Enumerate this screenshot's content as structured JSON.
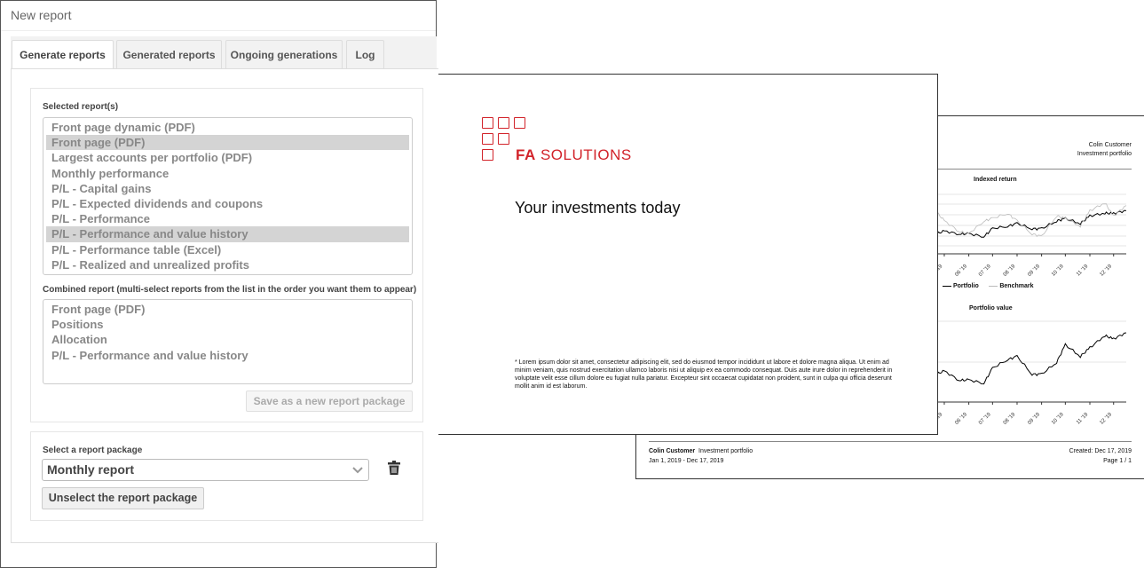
{
  "window": {
    "title": "New report"
  },
  "tabs": [
    {
      "label": "Generate reports",
      "active": true
    },
    {
      "label": "Generated reports"
    },
    {
      "label": "Ongoing generations"
    },
    {
      "label": "Log"
    }
  ],
  "selected_reports": {
    "label": "Selected report(s)",
    "items": [
      {
        "label": "Front page dynamic (PDF)"
      },
      {
        "label": "Front page (PDF)",
        "selected": true
      },
      {
        "label": "Largest accounts per portfolio (PDF)"
      },
      {
        "label": "Monthly performance"
      },
      {
        "label": "P/L - Capital gains"
      },
      {
        "label": "P/L - Expected dividends and coupons"
      },
      {
        "label": "P/L - Performance"
      },
      {
        "label": "P/L - Performance and value history",
        "selected": true
      },
      {
        "label": "P/L - Performance table (Excel)"
      },
      {
        "label": "P/L - Realized and unrealized profits"
      }
    ]
  },
  "combined_report": {
    "label": "Combined report (multi-select reports from the list in the order you want them to appear)",
    "items": [
      "Front page (PDF)",
      "Positions",
      "Allocation",
      "P/L - Performance and value history"
    ]
  },
  "save_button": "Save as a new report package",
  "package": {
    "label": "Select a report package",
    "value": "Monthly report",
    "unselect_button": "Unselect the report package",
    "delete_icon": "trash-icon"
  },
  "front_page": {
    "brand_bold": "FA",
    "brand_light": "SOLUTIONS",
    "brand_color": "#d2232a",
    "title": "Your investments today",
    "lorem": "* Lorem ipsum dolor sit amet, consectetur adipiscing elit, sed do eiusmod tempor incididunt ut labore et dolore magna aliqua. Ut enim ad minim veniam, quis nostrud exercitation ullamco laboris nisi ut aliquip ex ea commodo consequat. Duis aute irure dolor in reprehenderit in voluptate velit esse cillum dolore eu fugiat nulla pariatur. Excepteur sint occaecat cupidatat non proident, sunt in culpa qui officia deserunt mollit anim id est laborum."
  },
  "back_page": {
    "customer": "Colin Customer",
    "portfolio": "Investment portfolio",
    "created": "Created: Dec 17, 2019",
    "page": "Page 1 / 1",
    "period": "Jan 1, 2019 - Dec 17, 2019"
  },
  "chart_data": [
    {
      "type": "line",
      "title": "Indexed return",
      "x_ticks": [
        "04 '19",
        "05 '19",
        "06 '19",
        "07 '19",
        "08 '19",
        "09 '19",
        "10 '19",
        "11 '19",
        "12 '19"
      ],
      "grid": true,
      "legend_placement": "bottom",
      "series": [
        {
          "name": "Portfolio",
          "color": "#000000",
          "x": [
            "2019-03-20",
            "2019-04-01",
            "2019-04-20",
            "2019-05-01",
            "2019-05-20",
            "2019-06-01",
            "2019-06-20",
            "2019-07-01",
            "2019-07-20",
            "2019-08-01",
            "2019-08-20",
            "2019-09-01",
            "2019-09-20",
            "2019-10-01",
            "2019-10-20",
            "2019-11-01",
            "2019-11-20",
            "2019-12-01",
            "2019-12-17"
          ],
          "y": [
            97,
            98,
            99,
            100,
            99,
            99,
            98,
            101,
            102,
            103,
            101,
            101,
            104,
            105,
            103,
            106,
            107,
            107,
            108
          ]
        },
        {
          "name": "Benchmark",
          "color": "#bbbbbb",
          "x": [
            "2019-03-20",
            "2019-04-01",
            "2019-04-20",
            "2019-05-01",
            "2019-05-20",
            "2019-06-01",
            "2019-06-20",
            "2019-07-01",
            "2019-07-20",
            "2019-08-01",
            "2019-08-20",
            "2019-09-01",
            "2019-09-20",
            "2019-10-01",
            "2019-10-20",
            "2019-11-01",
            "2019-11-20",
            "2019-12-01",
            "2019-12-17"
          ],
          "y": [
            105,
            110,
            108,
            104,
            100,
            99,
            104,
            105,
            107,
            104,
            99,
            98,
            106,
            105,
            102,
            108,
            111,
            106,
            110
          ]
        }
      ]
    },
    {
      "type": "line",
      "title": "Portfolio value",
      "x_ticks": [
        "04 '19",
        "05 '19",
        "06 '19",
        "07 '19",
        "08 '19",
        "09 '19",
        "10 '19",
        "11 '19",
        "12 '19"
      ],
      "grid": true,
      "series": [
        {
          "name": "Portfolio",
          "color": "#000000",
          "x": [
            "2019-03-20",
            "2019-04-01",
            "2019-04-20",
            "2019-05-01",
            "2019-05-20",
            "2019-06-01",
            "2019-06-20",
            "2019-07-01",
            "2019-07-20",
            "2019-08-01",
            "2019-08-20",
            "2019-09-01",
            "2019-09-20",
            "2019-10-01",
            "2019-10-20",
            "2019-11-01",
            "2019-11-20",
            "2019-12-01",
            "2019-12-17"
          ],
          "y": [
            100,
            100,
            104,
            105,
            102,
            102,
            101,
            106,
            109,
            110,
            104,
            104,
            108,
            114,
            110,
            113,
            117,
            116,
            118
          ]
        }
      ]
    }
  ]
}
